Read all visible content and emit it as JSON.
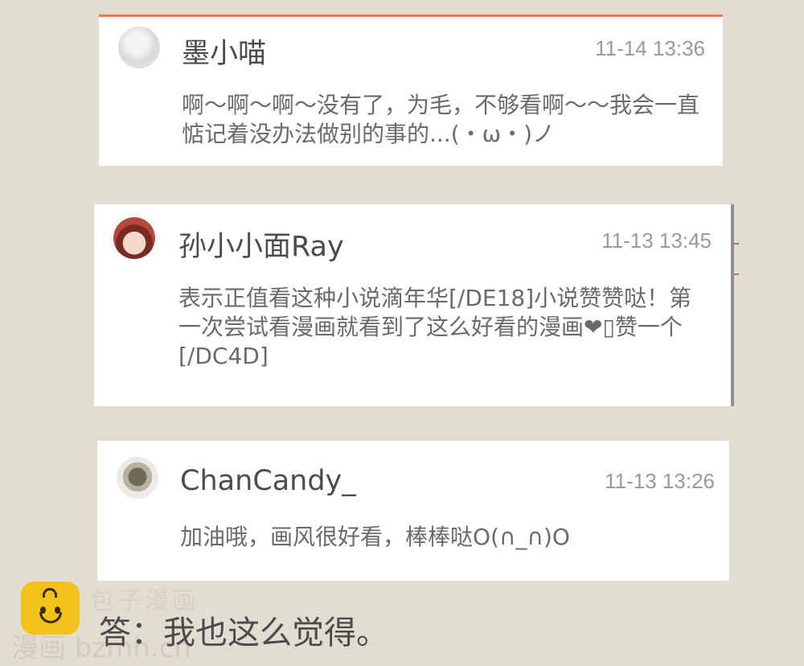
{
  "comments": [
    {
      "name": "墨小喵",
      "time": "11-14 13:36",
      "text": "啊～啊～啊～没有了，为毛，不够看啊～～我会一直惦记着没办法做别的事的...(・ω・)ノ"
    },
    {
      "name": "孙小小面Ray",
      "time": "11-13 13:45",
      "text": "表示正值看这种小说滴年华[/DE18]小说赞赞哒！第一次尝试看漫画就看到了这么好看的漫画❤︎▯赞一个[/DC4D]"
    },
    {
      "name": "ChanCandy_",
      "time": "11-13 13:26",
      "text": "加油哦，画风很好看，棒棒哒O(∩_∩)O"
    }
  ],
  "caption": "答：我也这么觉得。",
  "watermark": {
    "title": "包子漫画",
    "subtitle": "漫画 bzmh.cn"
  },
  "colors": {
    "background": "#e2ddd1",
    "accent": "#ee7a52",
    "logo": "#f3c21a"
  }
}
